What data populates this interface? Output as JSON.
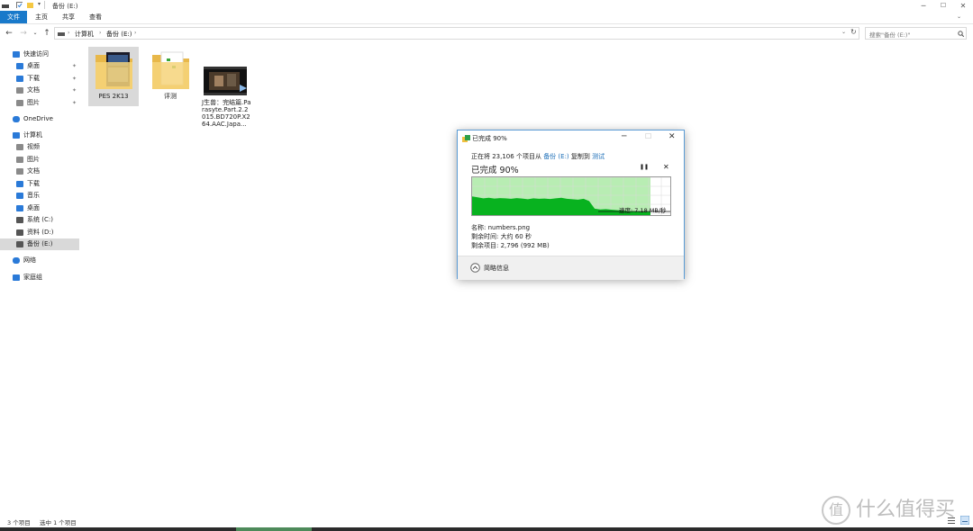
{
  "window": {
    "title": "备份 (E:)",
    "controls": [
      "─",
      "☐",
      "✕"
    ]
  },
  "ribbon": {
    "tabs": [
      "文件",
      "主页",
      "共享",
      "查看"
    ]
  },
  "address": {
    "path": [
      "计算机",
      "备份 (E:)"
    ],
    "search_placeholder": "搜索\"备份 (E:)\""
  },
  "sidebar": {
    "sections": [
      {
        "label": "快速访问",
        "icon": "star-icon",
        "level": 0
      },
      {
        "label": "桌面",
        "icon": "desktop-icon",
        "level": 1,
        "pinned": true
      },
      {
        "label": "下载",
        "icon": "download-icon",
        "level": 1,
        "pinned": true
      },
      {
        "label": "文档",
        "icon": "document-icon",
        "level": 1,
        "pinned": true
      },
      {
        "label": "图片",
        "icon": "picture-icon",
        "level": 1,
        "pinned": true
      },
      {
        "label": "OneDrive",
        "icon": "cloud-icon",
        "level": 0
      },
      {
        "label": "计算机",
        "icon": "computer-icon",
        "level": 0
      },
      {
        "label": "视频",
        "icon": "video-icon",
        "level": 1
      },
      {
        "label": "图片",
        "icon": "picture-icon",
        "level": 1
      },
      {
        "label": "文档",
        "icon": "document-icon",
        "level": 1
      },
      {
        "label": "下载",
        "icon": "download-icon",
        "level": 1
      },
      {
        "label": "音乐",
        "icon": "music-icon",
        "level": 1
      },
      {
        "label": "桌面",
        "icon": "desktop-icon",
        "level": 1
      },
      {
        "label": "系统 (C:)",
        "icon": "drive-icon",
        "level": 1
      },
      {
        "label": "资料 (D:)",
        "icon": "drive-icon",
        "level": 1
      },
      {
        "label": "备份 (E:)",
        "icon": "drive-icon",
        "level": 1,
        "selected": true
      },
      {
        "label": "网络",
        "icon": "network-icon",
        "level": 0
      },
      {
        "label": "家庭组",
        "icon": "homegroup-icon",
        "level": 0
      }
    ]
  },
  "files": [
    {
      "name": "PES 2K13",
      "type": "folder",
      "selected": true
    },
    {
      "name": "评测",
      "type": "folder"
    },
    {
      "name": "J生兽：完结篇.Parasyte.Part.2.2015.BD720P.X264.AAC.Japa...",
      "type": "video"
    }
  ],
  "status": {
    "count": "3 个项目",
    "selected": "选中 1 个项目"
  },
  "dialog": {
    "title": "已完成 90%",
    "line_prefix": "正在将 23,106 个项目从",
    "source": "备份 (E:)",
    "copy_to": "复制到",
    "dest": "测试",
    "progress_heading": "已完成 90%",
    "progress": 0.9,
    "speed": "速度: 7.18 MB/秒",
    "name_line": "名称: numbers.png",
    "time_line": "剩余时间: 大约 60 秒",
    "items_line": "剩余项目: 2,796 (992 MB)",
    "details_toggle": "简略信息",
    "pause_symbol": "❚❚",
    "close_symbol": "✕"
  },
  "watermark": "值 什么值得买",
  "colors": {
    "accent": "#1979ca",
    "graph_fill": "#08b21f",
    "graph_bg": "#b8edb3"
  }
}
